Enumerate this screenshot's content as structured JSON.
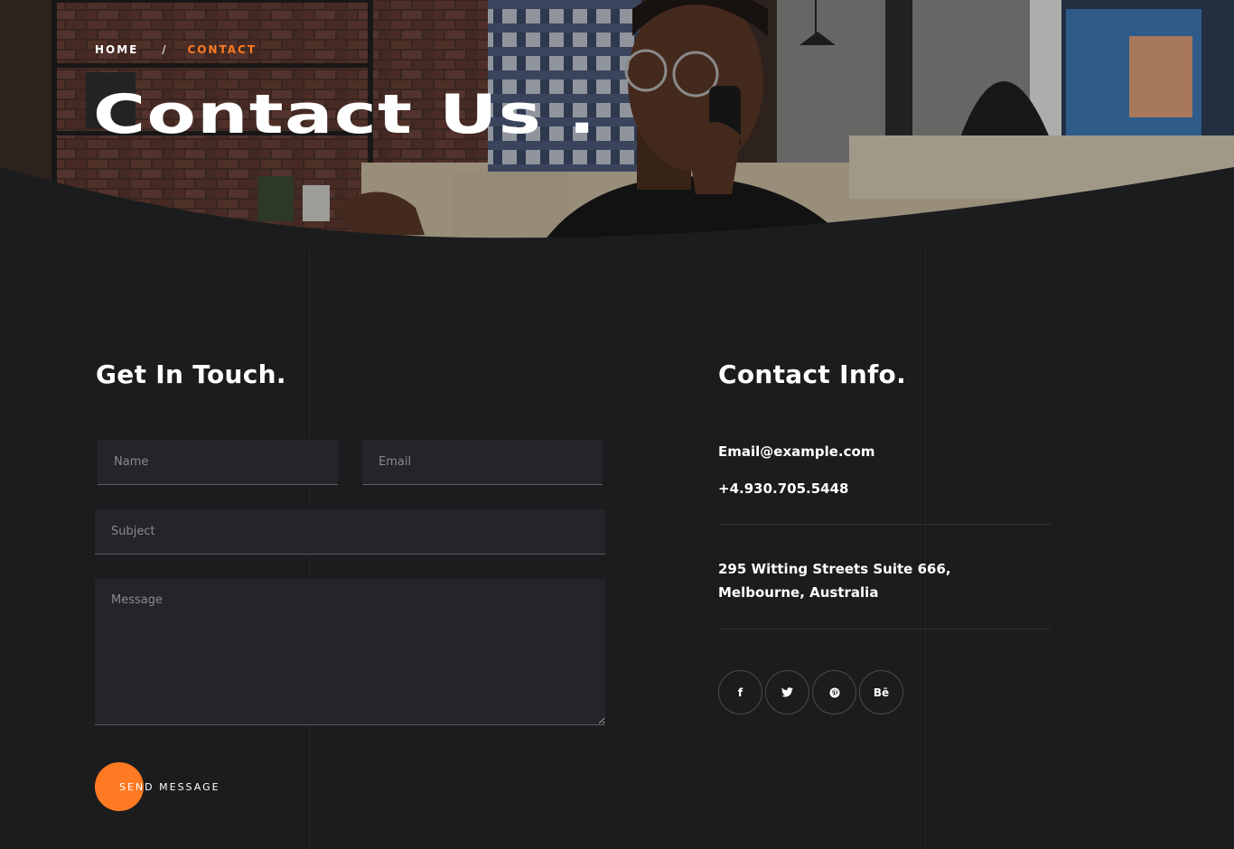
{
  "breadcrumb": {
    "home": "HOME",
    "separator": "/",
    "current": "CONTACT"
  },
  "hero": {
    "title": "Contact Us ."
  },
  "form": {
    "heading": "Get In Touch.",
    "name_placeholder": "Name",
    "email_placeholder": "Email",
    "subject_placeholder": "Subject",
    "message_placeholder": "Message",
    "send_label": "SEND MESSAGE"
  },
  "info": {
    "heading": "Contact Info.",
    "email": "Email@example.com",
    "phone": "+4.930.705.5448",
    "address_line1": "295 Witting Streets Suite 666,",
    "address_line2": "Melbourne, Australia"
  },
  "socials": [
    {
      "icon": "facebook-icon",
      "glyph": "f"
    },
    {
      "icon": "twitter-icon",
      "glyph": ""
    },
    {
      "icon": "pinterest-icon",
      "glyph": ""
    },
    {
      "icon": "behance-icon",
      "glyph": "Bē"
    }
  ],
  "colors": {
    "accent": "#ff7a22",
    "background": "#1b1c1e",
    "field": "#242528"
  }
}
